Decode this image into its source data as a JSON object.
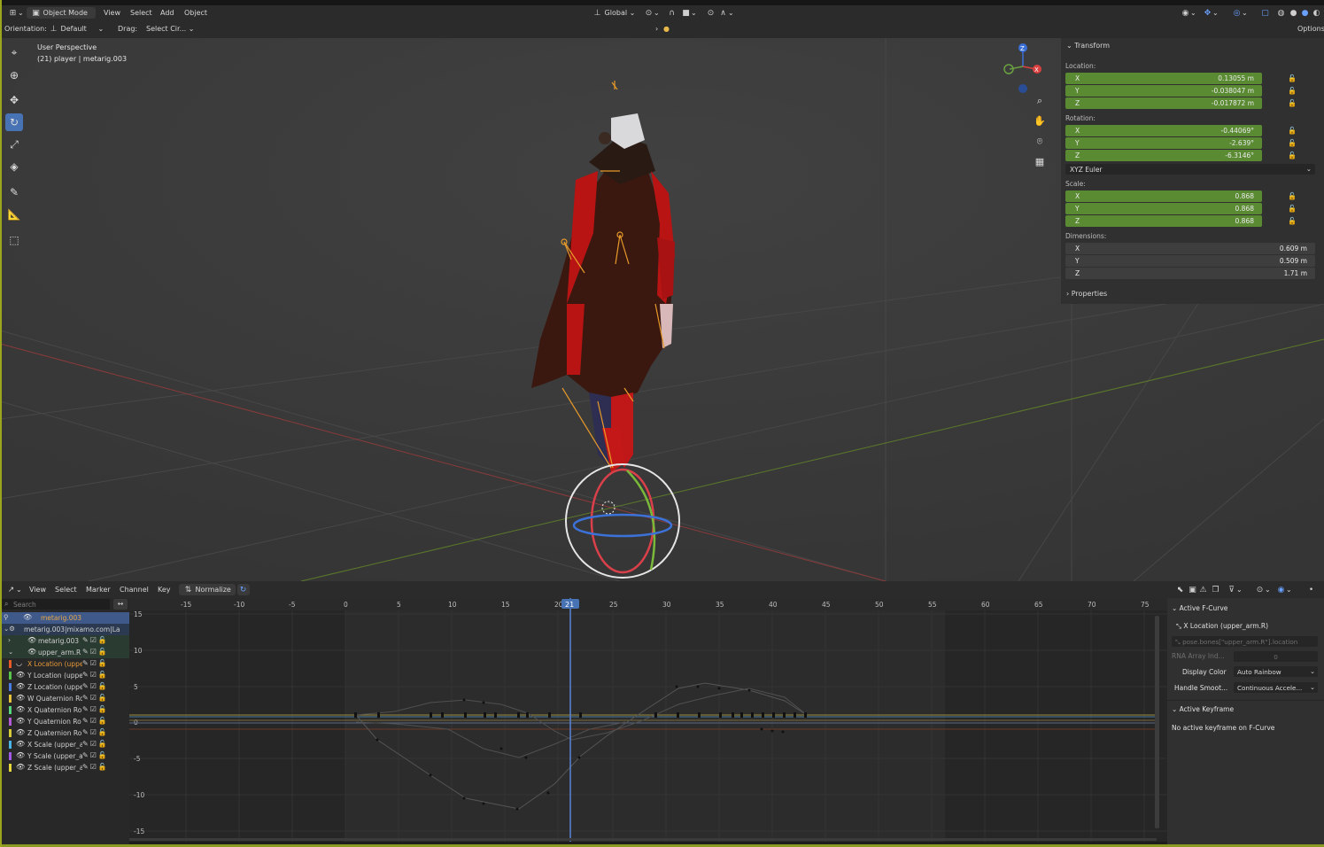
{
  "header": {
    "mode": "Object Mode",
    "menus": [
      "View",
      "Select",
      "Add",
      "Object"
    ],
    "transform_orientation": "Global"
  },
  "tool_settings": {
    "orientation_label": "Orientation:",
    "orientation_value": "Default",
    "drag_label": "Drag:",
    "drag_value": "Select Cir...",
    "options": "Options"
  },
  "viewport": {
    "perspective": "User Perspective",
    "object_info": "(21) player | metarig.003",
    "gizmo": {
      "x": "X",
      "y": "Y",
      "z": "Z"
    }
  },
  "npanel": {
    "section_transform": "Transform",
    "location_label": "Location:",
    "location": [
      {
        "axis": "X",
        "value": "0.13055 m"
      },
      {
        "axis": "Y",
        "value": "-0.038047 m"
      },
      {
        "axis": "Z",
        "value": "-0.017872 m"
      }
    ],
    "rotation_label": "Rotation:",
    "rotation": [
      {
        "axis": "X",
        "value": "-0.44069°"
      },
      {
        "axis": "Y",
        "value": "-2.639°"
      },
      {
        "axis": "Z",
        "value": "-6.3146°"
      }
    ],
    "rotation_mode": "XYZ Euler",
    "scale_label": "Scale:",
    "scale": [
      {
        "axis": "X",
        "value": "0.868"
      },
      {
        "axis": "Y",
        "value": "0.868"
      },
      {
        "axis": "Z",
        "value": "0.868"
      }
    ],
    "dimensions_label": "Dimensions:",
    "dimensions": [
      {
        "axis": "X",
        "value": "0.609 m"
      },
      {
        "axis": "Y",
        "value": "0.509 m"
      },
      {
        "axis": "Z",
        "value": "1.71 m"
      }
    ],
    "section_properties": "Properties"
  },
  "graph_editor": {
    "menus": [
      "View",
      "Select",
      "Marker",
      "Channel",
      "Key"
    ],
    "normalize": "Normalize",
    "search_placeholder": "Search",
    "current_frame": "21",
    "frame_ticks": [
      "-15",
      "-10",
      "-5",
      "0",
      "5",
      "10",
      "15",
      "20",
      "25",
      "30",
      "35",
      "40",
      "45",
      "50",
      "55",
      "60",
      "65",
      "70",
      "75"
    ],
    "value_ticks": [
      "15",
      "10",
      "5",
      "0",
      "-5",
      "-10",
      "-15"
    ],
    "channels": [
      {
        "label": "metarig.003",
        "color": "",
        "selected": true
      },
      {
        "label": "metarig.003|mixamo.com|La",
        "color": ""
      },
      {
        "label": "metarig.003",
        "color": ""
      },
      {
        "label": "upper_arm.R",
        "color": ""
      },
      {
        "label": "X Location (uppe",
        "color": "#e85a2a",
        "active": true
      },
      {
        "label": "Y Location (uppe",
        "color": "#58c44a"
      },
      {
        "label": "Z Location (uppe",
        "color": "#4a7ce6"
      },
      {
        "label": "W Quaternion Ro",
        "color": "#e6c23a"
      },
      {
        "label": "X Quaternion Ro",
        "color": "#56d67d"
      },
      {
        "label": "Y Quaternion Ro",
        "color": "#b45ad6"
      },
      {
        "label": "Z Quaternion Ro",
        "color": "#d6cc3a"
      },
      {
        "label": "X Scale (upper_a",
        "color": "#4ab4e6"
      },
      {
        "label": "Y Scale (upper_a",
        "color": "#a05ae6"
      },
      {
        "label": "Z Scale (upper_a",
        "color": "#e6d83a"
      }
    ]
  },
  "sidebar": {
    "active_fcurve": "Active F-Curve",
    "fcurve_name": "X Location (upper_arm.R)",
    "data_path": "pose.bones[\"upper_arm.R\"].location",
    "rna_label": "RNA Array Ind...",
    "rna_value": "0",
    "display_color_label": "Display Color",
    "display_color_value": "Auto Rainbow",
    "handle_label": "Handle Smoot...",
    "handle_value": "Continuous Accele...",
    "active_keyframe": "Active Keyframe",
    "no_keyframe": "No active keyframe on F-Curve"
  }
}
